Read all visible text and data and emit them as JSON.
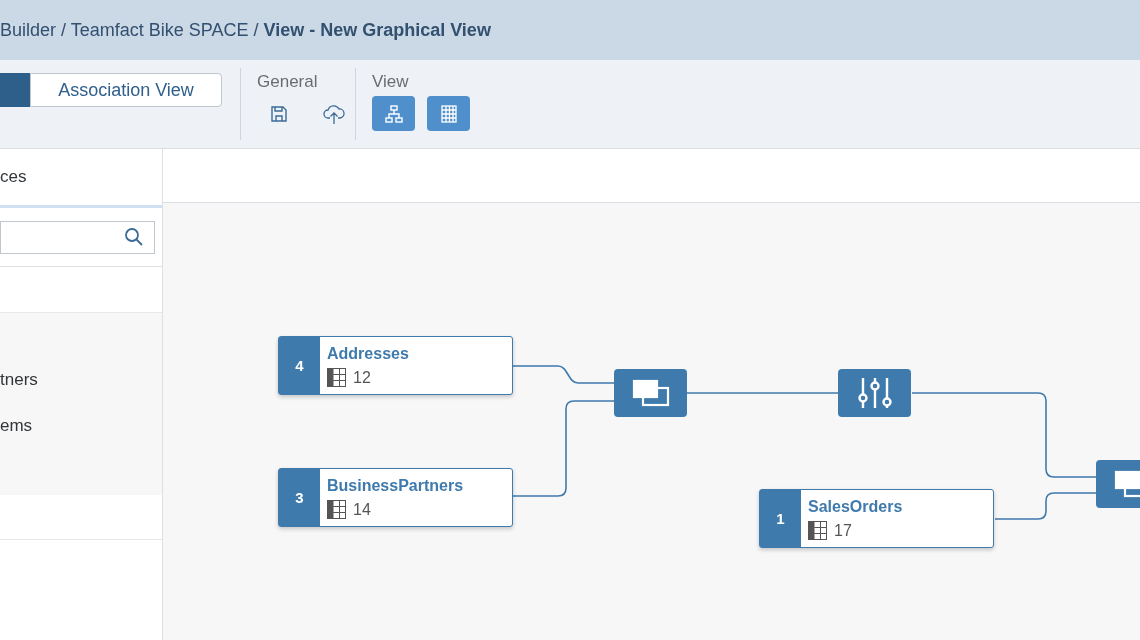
{
  "header": {
    "breadcrumb": "Builder / Teamfact Bike SPACE / **View - New Graphical View**"
  },
  "toolbar": {
    "view_switch": {
      "label": "Association View"
    },
    "groups": [
      {
        "title": "General",
        "tools": [
          {
            "kind": "save",
            "selected": false
          },
          {
            "kind": "upload",
            "selected": false
          }
        ]
      },
      {
        "title": "View",
        "tools": [
          {
            "kind": "diagram",
            "selected": true
          },
          {
            "kind": "grid",
            "selected": true
          }
        ]
      }
    ]
  },
  "sidebar": {
    "tab": "ces",
    "items": [
      "tners",
      "ems"
    ]
  },
  "nodes": [
    {
      "kind": "table",
      "number": "4",
      "name": "Addresses",
      "count": "12"
    },
    {
      "kind": "table",
      "number": "3",
      "name": "BusinessPartners",
      "count": "14"
    },
    {
      "kind": "table",
      "number": "1",
      "name": "SalesOrders",
      "count": "17"
    },
    {
      "kind": "union"
    },
    {
      "kind": "projection"
    },
    {
      "kind": "union"
    }
  ]
}
